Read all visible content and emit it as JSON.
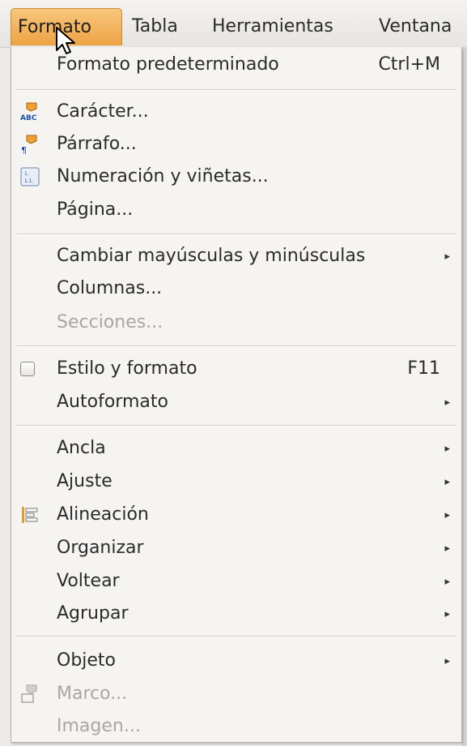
{
  "menubar": {
    "items": [
      {
        "label": "Formato"
      },
      {
        "label": "Tabla"
      },
      {
        "label": "Herramientas"
      },
      {
        "label": "Ventana"
      }
    ]
  },
  "menu": {
    "items": [
      {
        "label": "Formato predeterminado",
        "shortcut": "Ctrl+M"
      },
      {
        "label": "Carácter...",
        "icon": "character-abc-icon"
      },
      {
        "label": "Párrafo...",
        "icon": "paragraph-icon"
      },
      {
        "label": "Numeración y viñetas...",
        "icon": "numbering-icon"
      },
      {
        "label": "Página..."
      },
      {
        "label": "Cambiar mayúsculas y minúsculas",
        "submenu": true
      },
      {
        "label": "Columnas..."
      },
      {
        "label": "Secciones...",
        "disabled": true
      },
      {
        "label": "Estilo y formato",
        "shortcut": "F11",
        "checkbox": false
      },
      {
        "label": "Autoformato",
        "submenu": true
      },
      {
        "label": "Ancla",
        "submenu": true
      },
      {
        "label": "Ajuste",
        "submenu": true
      },
      {
        "label": "Alineación",
        "submenu": true,
        "icon": "align-icon"
      },
      {
        "label": "Organizar",
        "submenu": true
      },
      {
        "label": "Voltear",
        "submenu": true
      },
      {
        "label": "Agrupar",
        "submenu": true
      },
      {
        "label": "Objeto",
        "submenu": true
      },
      {
        "label": "Marco...",
        "disabled": true,
        "icon": "frame-icon"
      },
      {
        "label": "Imagen...",
        "disabled": true
      }
    ]
  },
  "colors": {
    "active_menu_bg": "#eea244",
    "menu_bg": "#f5f4f1",
    "disabled_text": "#a9a7a2"
  }
}
